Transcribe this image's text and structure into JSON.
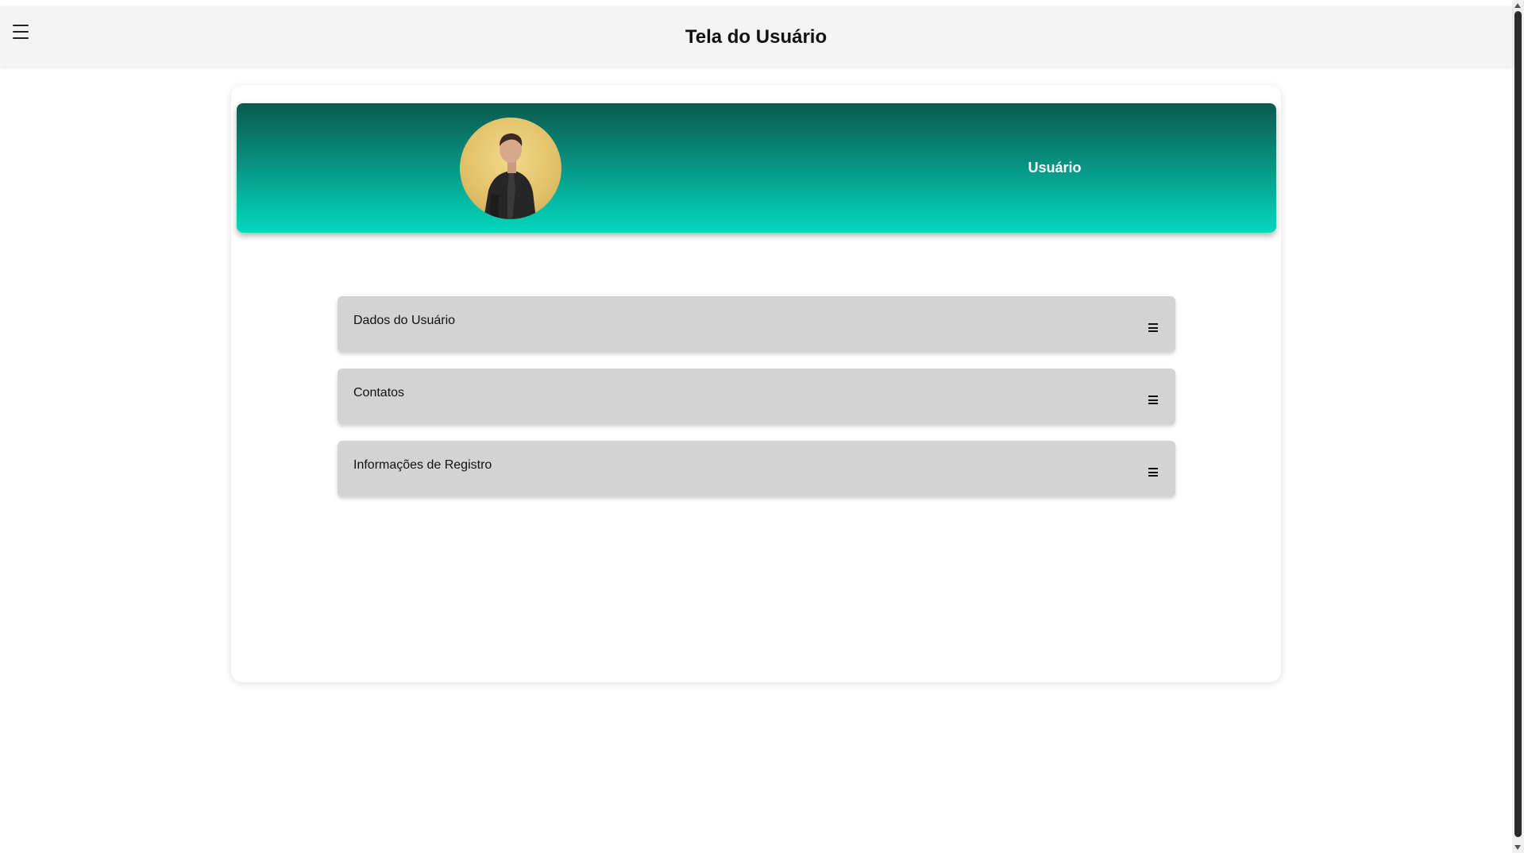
{
  "header": {
    "title": "Tela do Usuário",
    "menu_icon": "hamburger-menu-icon"
  },
  "profile": {
    "name": "Usuário",
    "avatar": "user-photo",
    "banner_colors": [
      "#0b5a4f",
      "#03d8bd"
    ]
  },
  "sections": [
    {
      "label": "Dados do Usuário",
      "icon": "menu-lines-icon"
    },
    {
      "label": "Contatos",
      "icon": "menu-lines-icon"
    },
    {
      "label": "Informações de Registro",
      "icon": "menu-lines-icon"
    }
  ]
}
